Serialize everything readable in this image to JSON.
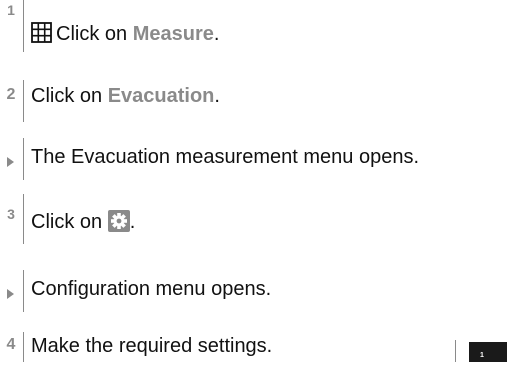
{
  "steps": [
    {
      "marker": "1",
      "prefix": "Click on ",
      "highlight": "Measure",
      "suffix": ".",
      "icon": "grid-icon"
    },
    {
      "marker": "2",
      "prefix": "Click on ",
      "highlight": "Evacuation",
      "suffix": "."
    },
    {
      "marker": "result",
      "text": "The Evacuation measurement menu opens."
    },
    {
      "marker": "3",
      "prefix": "Click on ",
      "suffix": ".",
      "icon": "gear-icon"
    },
    {
      "marker": "result",
      "text": "Configuration menu opens."
    },
    {
      "marker": "4",
      "text": "Make the required settings."
    }
  ],
  "page_badge": "1",
  "colors": {
    "accent_gray": "#8a8a8a",
    "text": "#111111",
    "badge_bg": "#1a1a1a"
  }
}
